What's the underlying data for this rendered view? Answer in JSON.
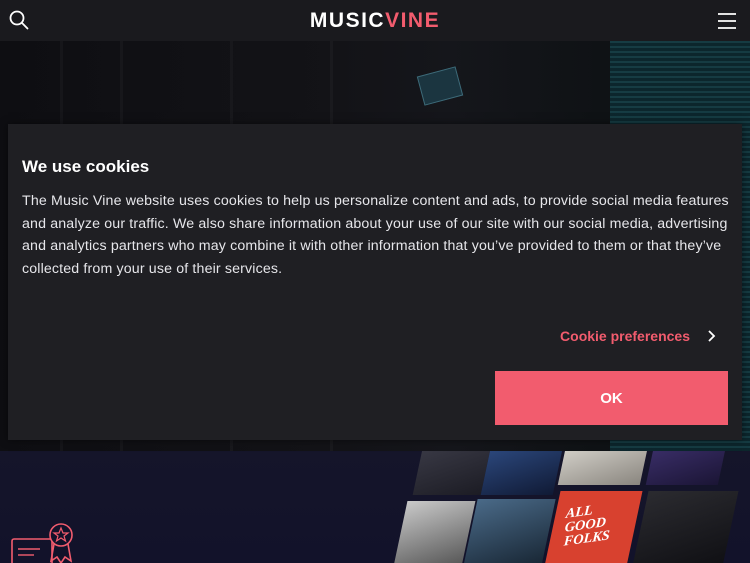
{
  "header": {
    "logo_part1": "MUSIC",
    "logo_part2": "VINE",
    "search_icon": "search-icon",
    "menu_icon": "hamburger-menu-icon"
  },
  "cookie_modal": {
    "title": "We use cookies",
    "body": "The Music Vine website uses cookies to help us personalize content and ads, to provide social media features and analyze our traffic. We also share information about your use of our site with our social media, advertising and analytics partners who may combine it with other information that you’ve provided to them or that they’ve collected from your use of their services.",
    "preferences_label": "Cookie preferences",
    "ok_label": "OK"
  },
  "lower": {
    "album_art_text": "ALL GOOD FOLKS"
  },
  "colors": {
    "accent": "#f25c6e",
    "header_bg": "#1a1a1e",
    "modal_bg": "#1f1f23"
  }
}
